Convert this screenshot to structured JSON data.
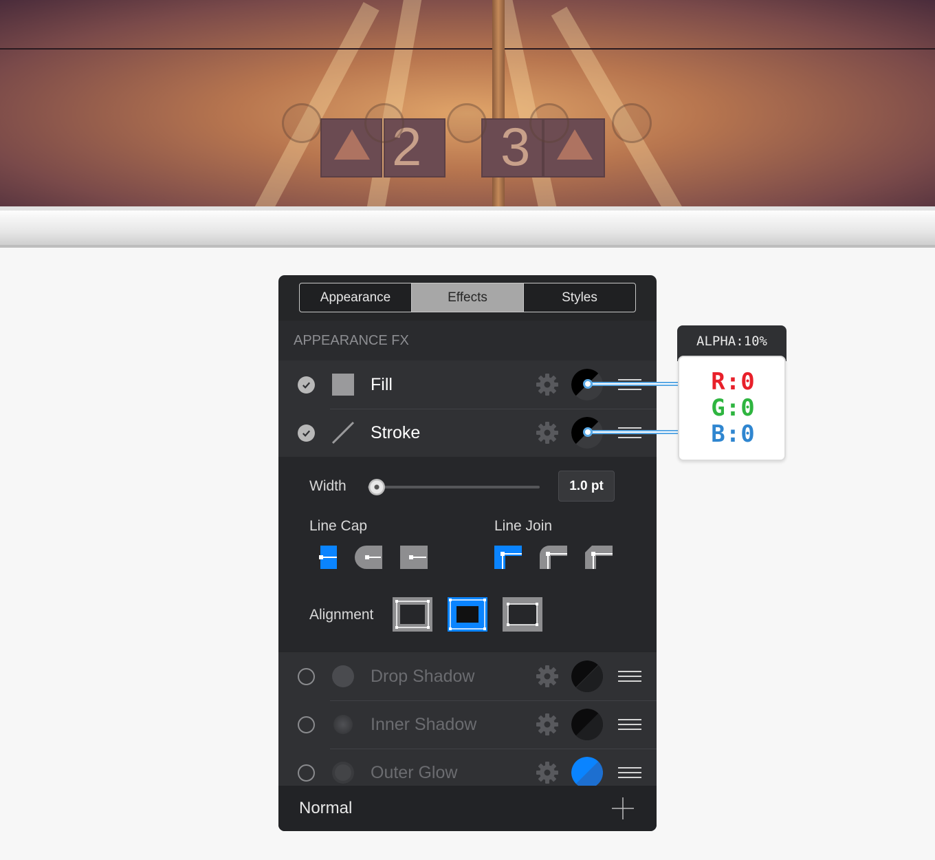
{
  "panel": {
    "tabs": [
      "Appearance",
      "Effects",
      "Styles"
    ],
    "active_tab": "Effects",
    "section_title": "APPEARANCE FX",
    "fx_rows": [
      {
        "label": "Fill",
        "checked": true,
        "swatch": "black",
        "icon": "fill-square-icon"
      },
      {
        "label": "Stroke",
        "checked": true,
        "swatch": "black",
        "icon": "stroke-line-icon"
      }
    ],
    "stroke_options": {
      "width_label": "Width",
      "width_value": "1.0 pt",
      "width_slider_fraction": 0.05,
      "line_cap_label": "Line Cap",
      "line_cap_selected": 0,
      "line_join_label": "Line Join",
      "line_join_selected": 0,
      "alignment_label": "Alignment",
      "alignment_selected": 1
    },
    "extra_rows": [
      {
        "label": "Drop Shadow",
        "checked": false,
        "swatch": "black"
      },
      {
        "label": "Inner Shadow",
        "checked": false,
        "swatch": "black"
      },
      {
        "label": "Outer Glow",
        "checked": false,
        "swatch": "blue"
      }
    ],
    "blend_mode": "Normal"
  },
  "callout": {
    "alpha": "ALPHA:10%",
    "r": "R:0",
    "g": "G:0",
    "b": "B:0"
  },
  "colors": {
    "accent_blue": "#0a84ff",
    "r": "#e8202a",
    "g": "#2fb540",
    "b": "#2f86d0",
    "leader": "#5aa8e4"
  },
  "banner": {
    "numbers": [
      "2",
      "3"
    ]
  }
}
